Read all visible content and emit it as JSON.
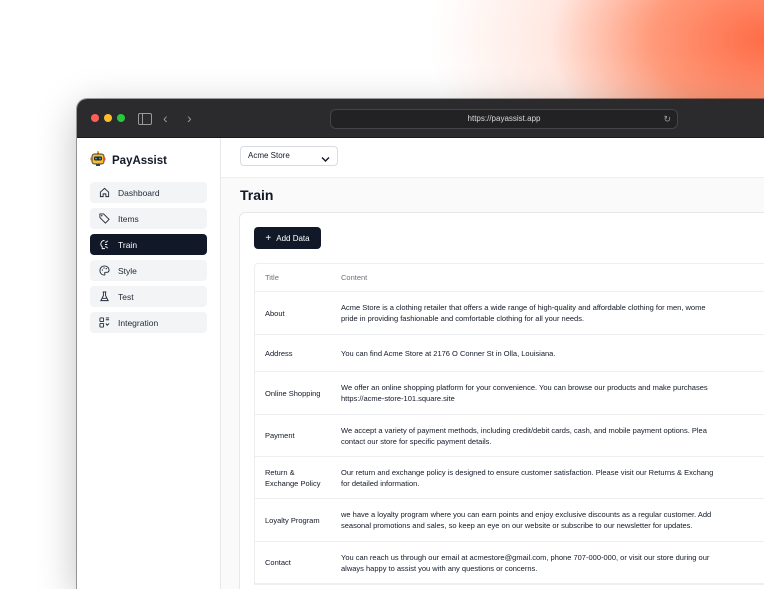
{
  "browser": {
    "url": "https://payassist.app"
  },
  "brand": {
    "name": "PayAssist"
  },
  "sidebar": {
    "items": [
      {
        "label": "Dashboard",
        "icon": "home-icon",
        "active": false
      },
      {
        "label": "Items",
        "icon": "tag-icon",
        "active": false
      },
      {
        "label": "Train",
        "icon": "brain-icon",
        "active": true
      },
      {
        "label": "Style",
        "icon": "palette-icon",
        "active": false
      },
      {
        "label": "Test",
        "icon": "flask-icon",
        "active": false
      },
      {
        "label": "Integration",
        "icon": "integration-icon",
        "active": false
      }
    ]
  },
  "topbar": {
    "store_selected": "Acme Store"
  },
  "main": {
    "title": "Train",
    "add_button_label": "Add Data",
    "table": {
      "columns": [
        "Title",
        "Content"
      ],
      "rows": [
        {
          "title": "About",
          "content": [
            "Acme Store is a clothing retailer that offers a wide range of high-quality and affordable clothing for men, wome",
            "pride in providing fashionable and comfortable clothing for all your needs."
          ]
        },
        {
          "title": "Address",
          "content": [
            "You can find Acme Store at 2176 O Conner St in Olla, Louisiana."
          ]
        },
        {
          "title": "Online Shopping",
          "content": [
            "We offer an online shopping platform for your convenience. You can browse our products and make purchases",
            "https://acme-store-101.square.site"
          ]
        },
        {
          "title": "Payment",
          "content": [
            "We accept a variety of payment methods, including credit/debit cards, cash, and mobile payment options. Plea",
            "contact our store for specific payment details."
          ]
        },
        {
          "title": "Return & Exchange Policy",
          "title_lines": [
            "Return &",
            "Exchange Policy"
          ],
          "content": [
            "Our return and exchange policy is designed to ensure customer satisfaction. Please visit our Returns & Exchang",
            "for detailed information."
          ]
        },
        {
          "title": "Loyalty Program",
          "content": [
            "we have a loyalty program where you can earn points and enjoy exclusive discounts as a regular customer. Add",
            "seasonal promotions and sales, so keep an eye on our website or subscribe to our newsletter for updates."
          ]
        },
        {
          "title": "Contact",
          "content": [
            "You can reach us through our email at acmestore@gmail.com, phone 707-000-000, or visit our store during our",
            "always happy to assist you with any questions or concerns."
          ]
        }
      ]
    }
  },
  "colors": {
    "accent_dark": "#111827",
    "glow": "#ff6a45"
  }
}
